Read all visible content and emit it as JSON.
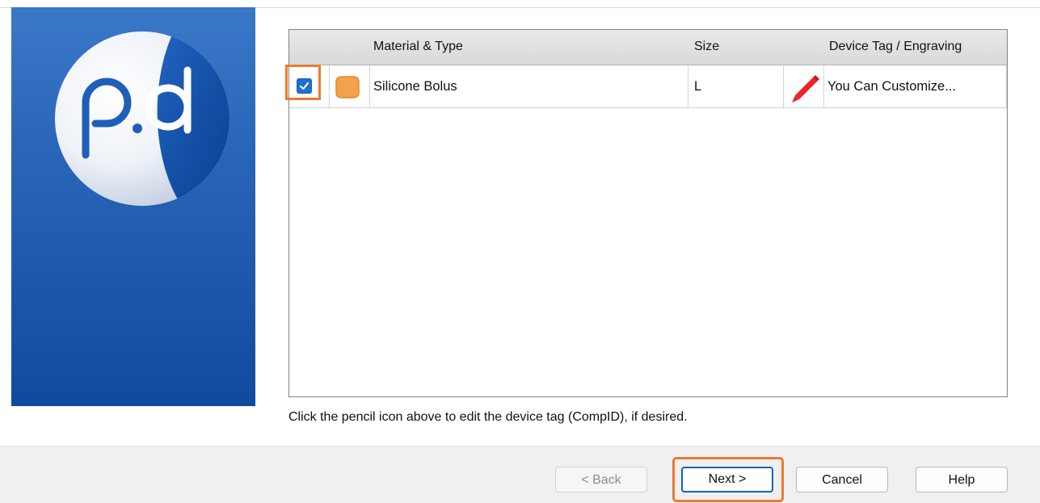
{
  "table": {
    "headers": {
      "material": "Material & Type",
      "size": "Size",
      "tag": "Device Tag / Engraving"
    },
    "rows": [
      {
        "checked": true,
        "swatch_color": "#f4a24a",
        "material": "Silicone Bolus",
        "size": "L",
        "tag": "You Can Customize..."
      }
    ]
  },
  "hint": "Click the pencil icon above to edit the device tag (CompID), if desired.",
  "buttons": {
    "back": "< Back",
    "next": "Next >",
    "cancel": "Cancel",
    "help": "Help"
  },
  "colors": {
    "sidebar": "#1c57ab",
    "highlight": "#ef7a2b",
    "pencil": "#e8262b",
    "checkbox": "#1f6fd1"
  },
  "icons": {
    "logo": "p.d-logo",
    "swatch": "material-swatch-icon",
    "pencil": "pencil-icon",
    "check": "checkbox-checked-icon"
  }
}
